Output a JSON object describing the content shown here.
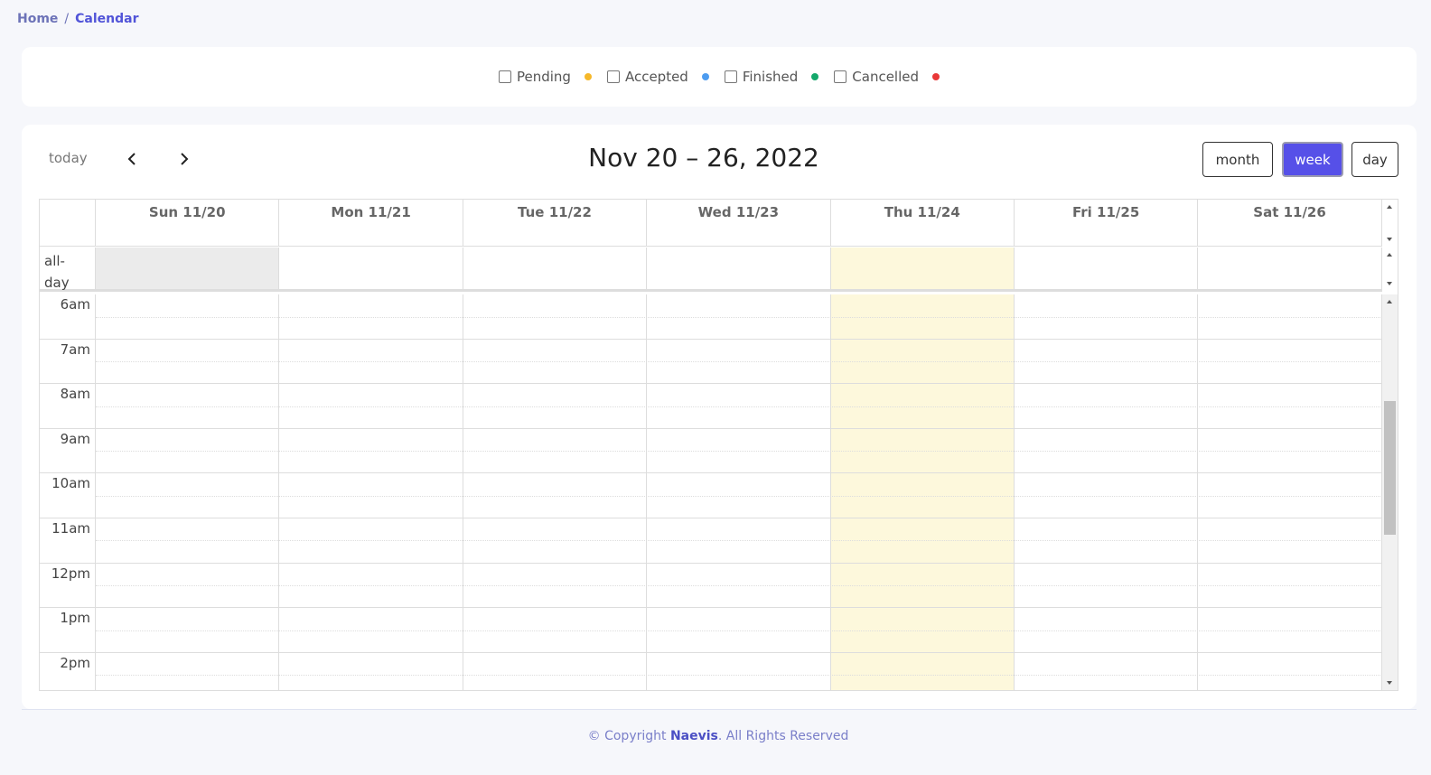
{
  "breadcrumb": {
    "home": "Home",
    "separator": "/",
    "current": "Calendar"
  },
  "filters": [
    {
      "label": "Pending",
      "color": "#f6b82a"
    },
    {
      "label": "Accepted",
      "color": "#4d9cf0"
    },
    {
      "label": "Finished",
      "color": "#14a86b"
    },
    {
      "label": "Cancelled",
      "color": "#e93838"
    }
  ],
  "toolbar": {
    "today": "today",
    "title": "Nov 20 – 26, 2022",
    "views": {
      "month": "month",
      "week": "week",
      "day": "day"
    },
    "active_view": "week",
    "prev_icon": "chevron-left-icon",
    "next_icon": "chevron-right-icon"
  },
  "calendar": {
    "days": [
      "Sun 11/20",
      "Mon 11/21",
      "Tue 11/22",
      "Wed 11/23",
      "Thu 11/24",
      "Fri 11/25",
      "Sat 11/26"
    ],
    "today_index": 4,
    "allday_label_1": "all-",
    "allday_label_2": "day",
    "hours": [
      "6am",
      "7am",
      "8am",
      "9am",
      "10am",
      "11am",
      "12pm",
      "1pm",
      "2pm"
    ],
    "today_color": "#fdf8dc"
  },
  "footer": {
    "prefix": "© Copyright ",
    "brand": "Naevis",
    "suffix": ". All Rights Reserved"
  }
}
